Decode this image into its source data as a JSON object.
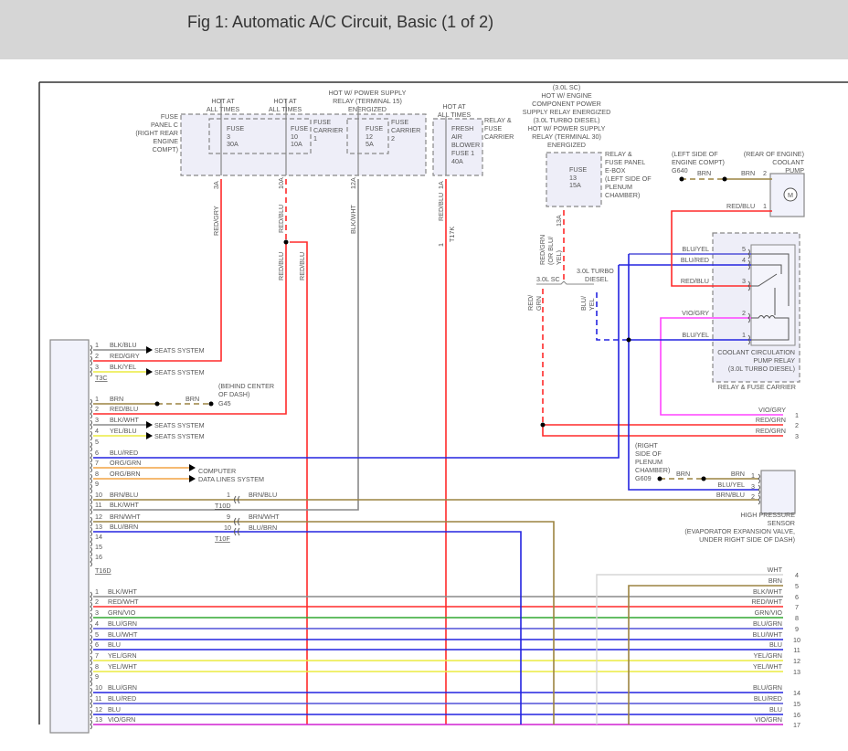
{
  "title": "Fig 1: Automatic A/C Circuit, Basic (1 of 2)",
  "fuse_panel_c": {
    "label": [
      "FUSE",
      "PANEL C",
      "(RIGHT REAR",
      "ENGINE",
      "COMPT)"
    ],
    "hot_1": [
      "HOT AT",
      "ALL TIMES"
    ],
    "fuse_3": [
      "FUSE",
      "3",
      "30A"
    ],
    "hot_2": [
      "HOT AT",
      "ALL TIMES"
    ],
    "fuse_10": [
      "FUSE",
      "10",
      "10A"
    ],
    "carrier_1": [
      "FUSE",
      "CARRIER",
      "1"
    ],
    "hot_3": [
      "HOT W/ POWER SUPPLY",
      "RELAY (TERMINAL 15)",
      "ENERGIZED"
    ],
    "fuse_12": [
      "FUSE",
      "12",
      "5A"
    ],
    "carrier_2": [
      "FUSE",
      "CARRIER",
      "2"
    ]
  },
  "relay_fuse_carrier_top": {
    "hot": [
      "HOT AT",
      "ALL TIMES"
    ],
    "fuse": [
      "FRESH",
      "AIR",
      "BLOWER",
      "FUSE 1",
      "40A"
    ],
    "label": [
      "RELAY &",
      "FUSE",
      "CARRIER"
    ]
  },
  "vertical_wires": {
    "w3a": "3A",
    "w3a_color": "RED/GRY",
    "w10a": "10A",
    "w10a_color": "RED/BLU",
    "w10a_color_2": "RED/BLU",
    "w10a_branch": "RED/BLU",
    "w12a": "12A",
    "w12a_color": "BLK/WHT",
    "w1a": "1A",
    "w1a_color": "RED/BLU",
    "t17k_pin": "1",
    "t17k": "T17K"
  },
  "ebox": {
    "hot": [
      "(3.0L SC)",
      "HOT W/ ENGINE",
      "COMPONENT POWER",
      "SUPPLY RELAY ENERGIZED",
      "(3.0L TURBO DIESEL)",
      "HOT W/ POWER SUPPLY",
      "RELAY (TERMINAL 30)",
      "ENERGIZED"
    ],
    "fuse_13": [
      "FUSE",
      "13",
      "15A"
    ],
    "label": [
      "RELAY &",
      "FUSE PANEL",
      "E-BOX",
      "(LEFT SIDE OF",
      "PLENUM",
      "CHAMBER)"
    ],
    "w13a": "13A",
    "w13a_color": [
      "RED/GRN",
      "(OR BLU/",
      "YEL)"
    ],
    "sc": "3.0L SC",
    "td": [
      "3.0L TURBO",
      "DIESEL"
    ],
    "sc_color": [
      "RED/",
      "GRN"
    ],
    "td_color": [
      "BLU/",
      "YEL"
    ]
  },
  "coolant_pump": {
    "ground_loc": [
      "(LEFT SIDE OF",
      "ENGINE COMPT)"
    ],
    "ground": "G640",
    "label": [
      "(REAR OF ENGINE)",
      "COOLANT",
      "PUMP"
    ],
    "wire_gnd_1": "BRN",
    "wire_gnd_2": "BRN",
    "pin_2": "2",
    "wire_1": "RED/BLU",
    "pin_1": "1",
    "motor": "M"
  },
  "relay": {
    "pins": [
      {
        "pin": "5",
        "wire": "BLU/YEL"
      },
      {
        "pin": "4",
        "wire": "BLU/RED"
      },
      {
        "pin": "3",
        "wire": "RED/BLU"
      },
      {
        "pin": "2",
        "wire": "VIO/GRY"
      },
      {
        "pin": "1",
        "wire": "BLU/YEL"
      }
    ],
    "label": [
      "COOLANT CIRCULATION",
      "PUMP RELAY",
      "(3.0L TURBO DIESEL)"
    ],
    "carrier": "RELAY & FUSE CARRIER"
  },
  "right_rows_top": [
    {
      "pin": "1",
      "wire": "VIO/GRY"
    },
    {
      "pin": "2",
      "wire": "RED/GRN"
    },
    {
      "pin": "3",
      "wire": "RED/GRN"
    }
  ],
  "g45": {
    "loc": [
      "(BEHIND CENTER",
      "OF DASH)"
    ],
    "name": "G45",
    "wire": "BRN"
  },
  "sensor": {
    "ground_loc": [
      "(RIGHT",
      "SIDE OF",
      "PLENUM",
      "CHAMBER)"
    ],
    "ground": "G609",
    "ground_wire": "BRN",
    "pins": [
      {
        "pin": "1",
        "wire": "BRN"
      },
      {
        "pin": "3",
        "wire": "BLU/YEL"
      },
      {
        "pin": "2",
        "wire": "BRN/BLU"
      }
    ],
    "label": [
      "HIGH PRESSURE",
      "SENSOR",
      "(EVAPORATOR EXPANSION VALVE,",
      "UNDER RIGHT SIDE OF DASH)"
    ]
  },
  "t3c": {
    "name": "T3C",
    "pins": [
      {
        "pin": "1",
        "wire": "BLK/BLU"
      },
      {
        "pin": "2",
        "wire": "RED/GRY"
      },
      {
        "pin": "3",
        "wire": "BLK/YEL"
      }
    ],
    "dest_1": "SEATS SYSTEM",
    "dest_3": "SEATS SYSTEM"
  },
  "t16d": {
    "name": "T16D",
    "pins": [
      {
        "pin": "1",
        "wire": "BRN"
      },
      {
        "pin": "2",
        "wire": "RED/BLU"
      },
      {
        "pin": "3",
        "wire": "BLK/WHT"
      },
      {
        "pin": "4",
        "wire": "YEL/BLU"
      },
      {
        "pin": "5",
        "wire": ""
      },
      {
        "pin": "6",
        "wire": "BLU/RED"
      },
      {
        "pin": "7",
        "wire": "ORG/GRN"
      },
      {
        "pin": "8",
        "wire": "ORG/BRN"
      },
      {
        "pin": "9",
        "wire": ""
      },
      {
        "pin": "10",
        "wire": "BRN/BLU"
      },
      {
        "pin": "11",
        "wire": "BLK/WHT"
      },
      {
        "pin": "12",
        "wire": "BRN/WHT"
      },
      {
        "pin": "13",
        "wire": "BLU/BRN"
      },
      {
        "pin": "14",
        "wire": ""
      },
      {
        "pin": "15",
        "wire": ""
      },
      {
        "pin": "16",
        "wire": ""
      }
    ],
    "dest_3": "SEATS SYSTEM",
    "dest_4": "SEATS SYSTEM",
    "dest_7": "COMPUTER",
    "dest_8": "DATA LINES SYSTEM"
  },
  "t10d": {
    "name": "T10D",
    "pin": "1",
    "wire": "BRN/BLU"
  },
  "t10f": {
    "name": "T10F",
    "pin_9": "9",
    "wire_9": "BRN/WHT",
    "pin_10": "10",
    "wire_10": "BLU/BRN"
  },
  "lower_conn": {
    "pins": [
      {
        "pin": "1",
        "wire": "BLK/WHT"
      },
      {
        "pin": "2",
        "wire": "RED/WHT"
      },
      {
        "pin": "3",
        "wire": "GRN/VIO"
      },
      {
        "pin": "4",
        "wire": "BLU/GRN"
      },
      {
        "pin": "5",
        "wire": "BLU/WHT"
      },
      {
        "pin": "6",
        "wire": "BLU"
      },
      {
        "pin": "7",
        "wire": "YEL/GRN"
      },
      {
        "pin": "8",
        "wire": "YEL/WHT"
      },
      {
        "pin": "9",
        "wire": ""
      },
      {
        "pin": "10",
        "wire": "BLU/GRN"
      },
      {
        "pin": "11",
        "wire": "BLU/RED"
      },
      {
        "pin": "12",
        "wire": "BLU"
      },
      {
        "pin": "13",
        "wire": "VIO/GRN"
      }
    ]
  },
  "right_rows_bottom": [
    {
      "pin": "4",
      "wire": "WHT"
    },
    {
      "pin": "5",
      "wire": "BRN"
    },
    {
      "pin": "6",
      "wire": "BLK/WHT"
    },
    {
      "pin": "7",
      "wire": "RED/WHT"
    },
    {
      "pin": "8",
      "wire": "GRN/VIO"
    },
    {
      "pin": "9",
      "wire": "BLU/GRN"
    },
    {
      "pin": "10",
      "wire": "BLU/WHT"
    },
    {
      "pin": "11",
      "wire": "BLU"
    },
    {
      "pin": "12",
      "wire": "YEL/GRN"
    },
    {
      "pin": "13",
      "wire": "YEL/WHT"
    },
    {
      "pin": "14",
      "wire": "BLU/GRN"
    },
    {
      "pin": "15",
      "wire": "BLU/RED"
    },
    {
      "pin": "16",
      "wire": "BLU"
    },
    {
      "pin": "17",
      "wire": "VIO/GRN"
    }
  ],
  "colors": {
    "red": "#ff2a2a",
    "gray": "#8a8a8a",
    "blue": "#2424e0",
    "brown": "#9c8440",
    "yellow": "#ecec40",
    "orange": "#f2a444",
    "green": "#30a830",
    "pink": "#ff44ff",
    "violet": "#d020d0",
    "bluered": "#5050d8"
  }
}
